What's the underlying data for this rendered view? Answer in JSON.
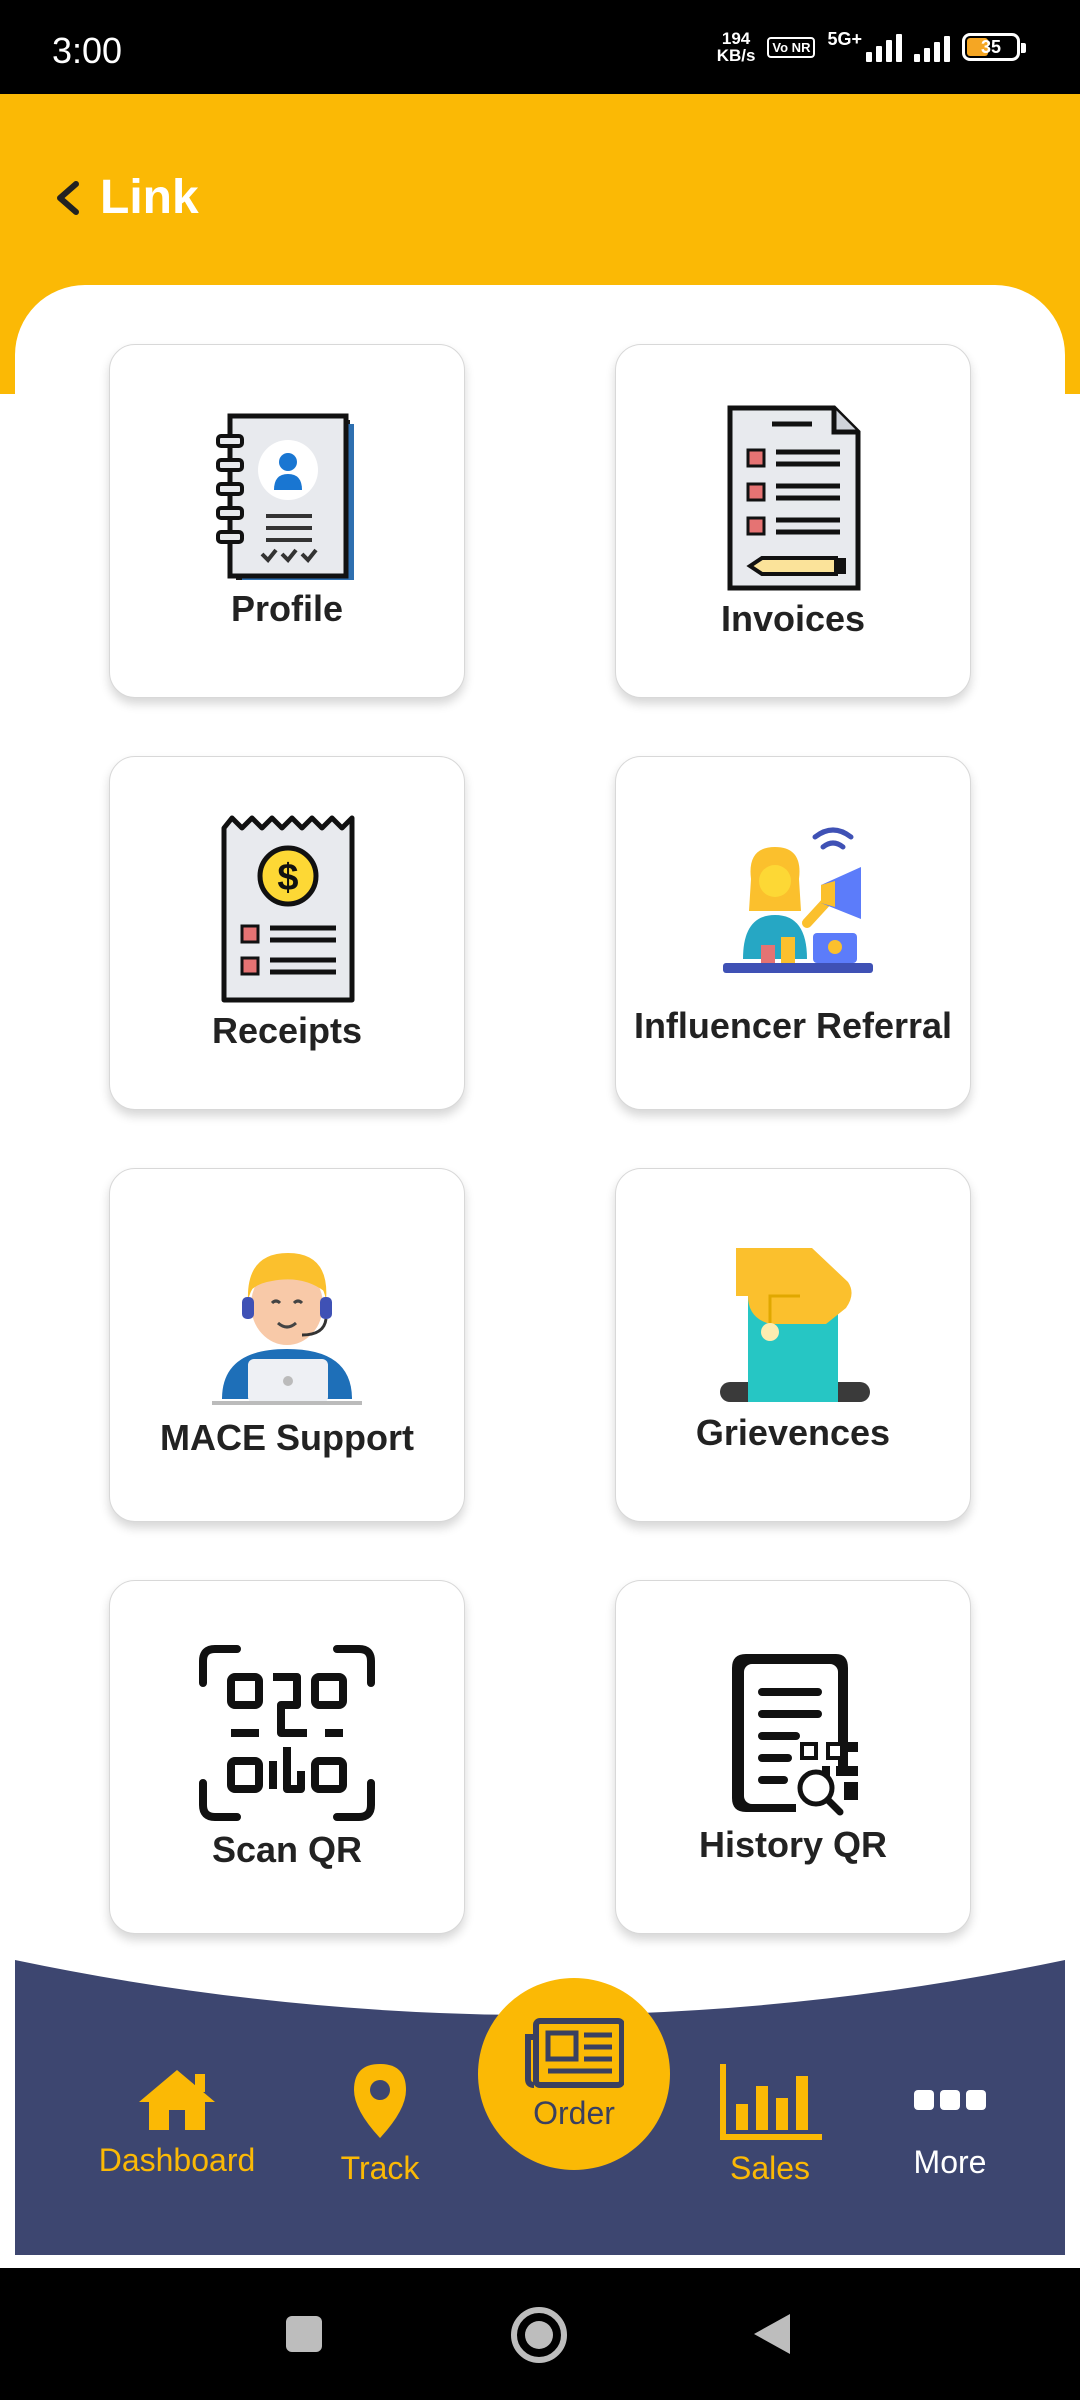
{
  "status_bar": {
    "time": "3:00",
    "net_speed_value": "194",
    "net_speed_unit": "KB/s",
    "volte": "Vo NR",
    "network": "5G+",
    "battery": "35"
  },
  "header": {
    "title": "Link",
    "back_icon": "chevron-left-icon",
    "background": "#fbb905"
  },
  "tiles": [
    {
      "label": "Profile",
      "icon": "profile-notebook-icon"
    },
    {
      "label": "Invoices",
      "icon": "invoice-document-icon"
    },
    {
      "label": "Receipts",
      "icon": "receipt-dollar-icon"
    },
    {
      "label": "Influencer Referral",
      "icon": "influencer-megaphone-icon"
    },
    {
      "label": "MACE Support",
      "icon": "support-agent-icon"
    },
    {
      "label": "Grievences",
      "icon": "ballot-box-icon"
    },
    {
      "label": "Scan QR",
      "icon": "qr-scan-icon"
    },
    {
      "label": "History QR",
      "icon": "qr-history-icon"
    }
  ],
  "bottom_nav": {
    "items": [
      {
        "label": "Dashboard",
        "icon": "home-icon",
        "color": "#fbb905"
      },
      {
        "label": "Track",
        "icon": "location-pin-icon",
        "color": "#fbb905"
      },
      {
        "label": "Order",
        "icon": "newspaper-icon",
        "color": "#3a4060"
      },
      {
        "label": "Sales",
        "icon": "bar-chart-icon",
        "color": "#fbb905"
      },
      {
        "label": "More",
        "icon": "more-dots-icon",
        "color": "#ffffff"
      }
    ],
    "background": "#3d4670"
  },
  "system_nav": {
    "buttons": [
      "recents-square-icon",
      "home-circle-icon",
      "back-triangle-icon"
    ]
  }
}
